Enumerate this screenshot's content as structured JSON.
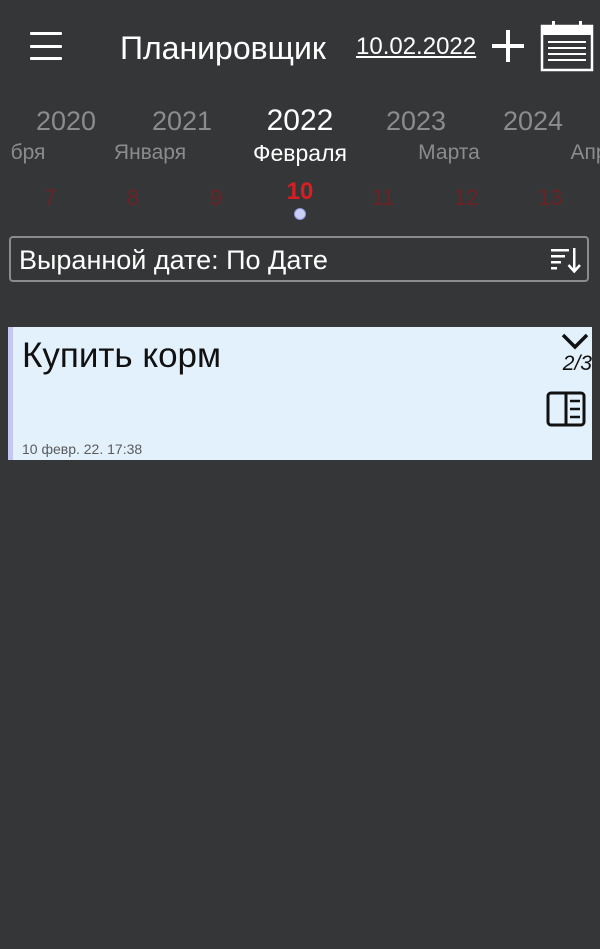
{
  "header": {
    "menu_icon": "hamburger-menu-icon",
    "title": "Планировщик",
    "current_date": "10.02.2022",
    "add_icon": "plus-icon",
    "calendar_icon": "calendar-icon"
  },
  "picker": {
    "years": [
      "2020",
      "2021",
      "2022",
      "2023",
      "2024"
    ],
    "selected_year": "2022",
    "months": [
      "бря",
      "Января",
      "Февраля",
      "Марта",
      "Апр"
    ],
    "selected_month": "Февраля",
    "days": [
      "7",
      "8",
      "9",
      "10",
      "11",
      "12",
      "13"
    ],
    "selected_day": "10"
  },
  "sort": {
    "label": "Выранной дате: По Дате",
    "icon": "sort-icon"
  },
  "tasks": [
    {
      "title": "Купить корм",
      "counter": "2/3",
      "timestamp": "10 февр. 22. 17:38",
      "expand_icon": "chevron-down-icon",
      "detail_icon": "split-view-icon"
    }
  ],
  "colors": {
    "background": "#343637",
    "accent_red": "#d61f25",
    "card_background": "#e3f1fd"
  }
}
